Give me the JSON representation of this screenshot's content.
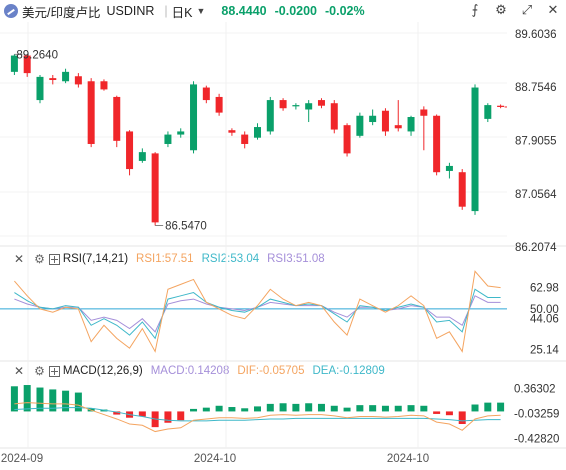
{
  "header": {
    "symbol_name": "美元/印度卢比",
    "symbol_code": "USDINR",
    "period": "日K",
    "price": "88.4440",
    "change": "-0.0200",
    "change_pct": "-0.02%",
    "icons": [
      "symbol-icon",
      "chevron-down-icon",
      "indicator-icon",
      "settings-icon",
      "expand-icon",
      "close-icon"
    ]
  },
  "colors": {
    "up": "#0aa06a",
    "down": "#f0262a",
    "rsi1": "#f4a460",
    "rsi2": "#3fb8c9",
    "rsi3": "#a58fd9",
    "diff": "#f4a460",
    "dea": "#3fb8c9",
    "level50": "#2ea8d6"
  },
  "main_chart": {
    "high_label": "89.2640",
    "low_label": "86.5470",
    "y_ticks": [
      "89.6036",
      "88.7546",
      "87.9055",
      "87.0564",
      "86.2074"
    ]
  },
  "x_labels": [
    "2024-09",
    "2024-10",
    "2024-10"
  ],
  "rsi": {
    "title": "RSI(7,14,21)",
    "rsi1": "RSI1:57.51",
    "rsi2": "RSI2:53.04",
    "rsi3": "RSI3:51.08",
    "y_ticks": [
      "62.98",
      "50.00",
      "44.06",
      "25.14"
    ]
  },
  "macd": {
    "title": "MACD(12,26,9)",
    "macd": "MACD:0.14208",
    "dif": "DIF:-0.05705",
    "dea": "DEA:-0.12809",
    "y_ticks": [
      "0.36302",
      "-0.03259",
      "-0.42820"
    ]
  },
  "chart_data": {
    "type": "candlestick",
    "title": "USDINR 日K",
    "y_range": [
      86.2074,
      89.6036
    ],
    "candles": [
      {
        "o": 89.0,
        "c": 89.26,
        "h": 89.28,
        "l": 88.95
      },
      {
        "o": 89.26,
        "c": 88.98,
        "h": 89.28,
        "l": 88.92
      },
      {
        "o": 88.55,
        "c": 88.92,
        "h": 88.95,
        "l": 88.5
      },
      {
        "o": 88.9,
        "c": 88.87,
        "h": 88.95,
        "l": 88.8
      },
      {
        "o": 88.85,
        "c": 89.0,
        "h": 89.05,
        "l": 88.82
      },
      {
        "o": 88.93,
        "c": 88.8,
        "h": 88.98,
        "l": 88.75
      },
      {
        "o": 88.85,
        "c": 87.85,
        "h": 88.9,
        "l": 87.8
      },
      {
        "o": 88.85,
        "c": 88.72,
        "h": 88.88,
        "l": 88.7
      },
      {
        "o": 88.6,
        "c": 87.9,
        "h": 88.62,
        "l": 87.8
      },
      {
        "o": 88.05,
        "c": 87.45,
        "h": 88.07,
        "l": 87.35
      },
      {
        "o": 87.58,
        "c": 87.72,
        "h": 87.78,
        "l": 87.55
      },
      {
        "o": 87.7,
        "c": 86.6,
        "h": 87.72,
        "l": 86.55
      },
      {
        "o": 87.85,
        "c": 88.0,
        "h": 88.05,
        "l": 87.8
      },
      {
        "o": 88.0,
        "c": 88.05,
        "h": 88.1,
        "l": 87.95
      },
      {
        "o": 87.75,
        "c": 88.8,
        "h": 88.85,
        "l": 87.7
      },
      {
        "o": 88.75,
        "c": 88.55,
        "h": 88.78,
        "l": 88.5
      },
      {
        "o": 88.6,
        "c": 88.35,
        "h": 88.65,
        "l": 88.3
      },
      {
        "o": 88.07,
        "c": 88.03,
        "h": 88.1,
        "l": 87.98
      },
      {
        "o": 88.0,
        "c": 87.85,
        "h": 88.05,
        "l": 87.78
      },
      {
        "o": 87.95,
        "c": 88.12,
        "h": 88.18,
        "l": 87.92
      },
      {
        "o": 88.05,
        "c": 88.55,
        "h": 88.6,
        "l": 88.0
      },
      {
        "o": 88.55,
        "c": 88.42,
        "h": 88.58,
        "l": 88.38
      },
      {
        "o": 88.45,
        "c": 88.47,
        "h": 88.5,
        "l": 88.4
      },
      {
        "o": 88.4,
        "c": 88.5,
        "h": 88.55,
        "l": 88.2
      },
      {
        "o": 88.55,
        "c": 88.46,
        "h": 88.58,
        "l": 88.42
      },
      {
        "o": 88.5,
        "c": 88.08,
        "h": 88.55,
        "l": 88.02
      },
      {
        "o": 88.15,
        "c": 87.7,
        "h": 88.18,
        "l": 87.65
      },
      {
        "o": 87.98,
        "c": 88.3,
        "h": 88.35,
        "l": 87.95
      },
      {
        "o": 88.2,
        "c": 88.3,
        "h": 88.4,
        "l": 88.15
      },
      {
        "o": 88.38,
        "c": 88.05,
        "h": 88.42,
        "l": 87.98
      },
      {
        "o": 88.15,
        "c": 88.1,
        "h": 88.55,
        "l": 88.05
      },
      {
        "o": 88.05,
        "c": 88.28,
        "h": 88.3,
        "l": 87.98
      },
      {
        "o": 88.4,
        "c": 88.3,
        "h": 88.45,
        "l": 87.75
      },
      {
        "o": 88.3,
        "c": 87.4,
        "h": 88.32,
        "l": 87.35
      },
      {
        "o": 87.42,
        "c": 87.5,
        "h": 87.55,
        "l": 87.3
      },
      {
        "o": 87.4,
        "c": 86.85,
        "h": 87.45,
        "l": 86.8
      },
      {
        "o": 86.78,
        "c": 88.75,
        "h": 88.8,
        "l": 86.72
      },
      {
        "o": 88.25,
        "c": 88.47,
        "h": 88.5,
        "l": 88.2
      },
      {
        "o": 88.46,
        "c": 88.44,
        "h": 88.48,
        "l": 88.42
      }
    ],
    "rsi": {
      "y_range": [
        20,
        75
      ],
      "rsi1": [
        67,
        58,
        50,
        48,
        51,
        50,
        30,
        40,
        32,
        26,
        38,
        24,
        62,
        65,
        68,
        54,
        50,
        46,
        44,
        52,
        62,
        56,
        52,
        54,
        52,
        42,
        34,
        56,
        52,
        48,
        52,
        58,
        52,
        32,
        36,
        24,
        73,
        64,
        63
      ],
      "rsi2": [
        60,
        55,
        51,
        50,
        52,
        51,
        40,
        44,
        40,
        34,
        42,
        32,
        56,
        58,
        60,
        54,
        51,
        49,
        48,
        51,
        56,
        54,
        52,
        53,
        52,
        47,
        42,
        52,
        51,
        49,
        51,
        53,
        51,
        42,
        43,
        36,
        62,
        57,
        57
      ],
      "rsi3": [
        56,
        53,
        51,
        50,
        51,
        51,
        43,
        45,
        43,
        38,
        44,
        36,
        53,
        55,
        56,
        53,
        51,
        50,
        49,
        51,
        54,
        53,
        52,
        52,
        52,
        48,
        45,
        51,
        51,
        49,
        50,
        52,
        51,
        45,
        45,
        40,
        58,
        54,
        54
      ]
    },
    "macd": {
      "y_range": [
        -0.55,
        0.5
      ],
      "hist": [
        0.4,
        0.42,
        0.38,
        0.35,
        0.33,
        0.3,
        0.05,
        0.03,
        -0.05,
        -0.1,
        -0.08,
        -0.25,
        -0.18,
        -0.14,
        0.04,
        0.06,
        0.09,
        0.07,
        0.05,
        0.08,
        0.12,
        0.13,
        0.12,
        0.13,
        0.12,
        0.09,
        0.06,
        0.1,
        0.1,
        0.09,
        0.09,
        0.1,
        0.09,
        -0.04,
        -0.06,
        -0.2,
        0.11,
        0.14,
        0.14
      ],
      "dif": [
        0.12,
        0.14,
        0.13,
        0.12,
        0.12,
        0.1,
        0.02,
        -0.05,
        -0.12,
        -0.2,
        -0.22,
        -0.32,
        -0.28,
        -0.26,
        -0.14,
        -0.12,
        -0.1,
        -0.1,
        -0.11,
        -0.1,
        -0.06,
        -0.05,
        -0.06,
        -0.05,
        -0.05,
        -0.07,
        -0.1,
        -0.08,
        -0.08,
        -0.09,
        -0.08,
        -0.06,
        -0.07,
        -0.17,
        -0.2,
        -0.3,
        -0.12,
        -0.07,
        -0.06
      ],
      "dea": [
        0.03,
        0.04,
        0.05,
        0.05,
        0.06,
        0.06,
        0.05,
        0.02,
        -0.01,
        -0.05,
        -0.08,
        -0.12,
        -0.14,
        -0.15,
        -0.15,
        -0.15,
        -0.14,
        -0.14,
        -0.14,
        -0.13,
        -0.12,
        -0.12,
        -0.11,
        -0.11,
        -0.11,
        -0.11,
        -0.11,
        -0.11,
        -0.11,
        -0.11,
        -0.11,
        -0.11,
        -0.11,
        -0.12,
        -0.13,
        -0.15,
        -0.14,
        -0.13,
        -0.13
      ]
    }
  }
}
